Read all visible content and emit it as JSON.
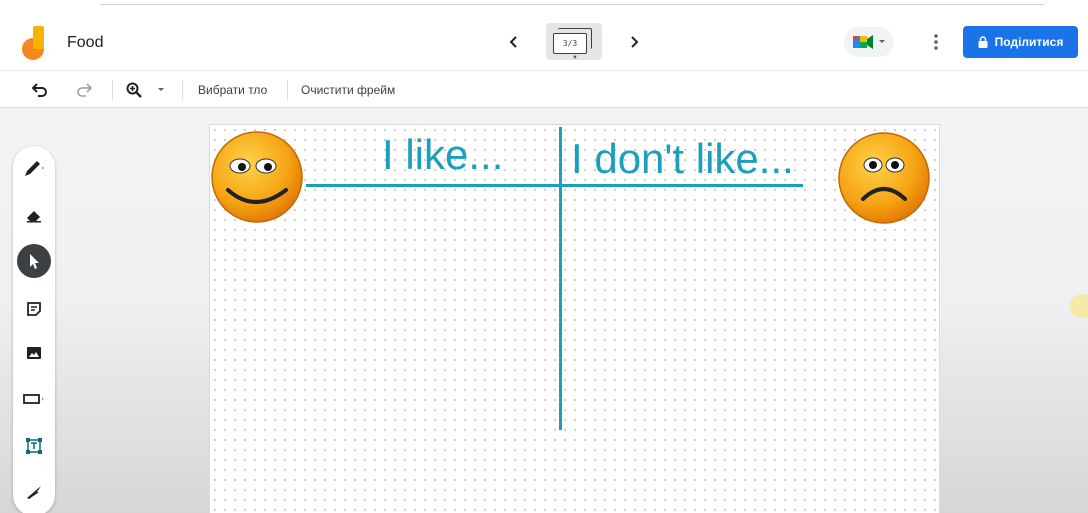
{
  "header": {
    "doc_title": "Food",
    "frame_indicator": "3/3",
    "share_label": "Поділитися"
  },
  "toolbar": {
    "set_background_label": "Вибрати тло",
    "clear_frame_label": "Очистити фрейм"
  },
  "canvas": {
    "left_heading": "I like...",
    "right_heading": "I don't like..."
  },
  "icons": {
    "logo": "jamboard-logo-icon",
    "prev": "chevron-left-icon",
    "next": "chevron-right-icon",
    "meet": "google-meet-icon",
    "more": "more-vert-icon",
    "lock": "lock-icon",
    "undo": "undo-icon",
    "redo": "redo-icon",
    "zoom": "zoom-in-icon",
    "sidebar": [
      "pen-icon",
      "eraser-icon",
      "select-arrow-icon",
      "sticky-note-icon",
      "image-icon",
      "shape-icon",
      "text-box-icon",
      "laser-icon"
    ]
  },
  "colors": {
    "accent_blue": "#1a73e8",
    "canvas_text": "#1aa0bd",
    "logo_yellow": "#f5b400",
    "logo_orange": "#f4871f"
  }
}
